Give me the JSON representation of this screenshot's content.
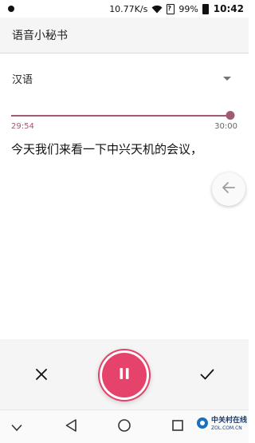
{
  "status_bar": {
    "network_speed": "10.77K/s",
    "sim_badge": "?",
    "battery_percent": "99%",
    "time": "10:42"
  },
  "app_bar": {
    "title": "语音小秘书"
  },
  "language": {
    "selected": "汉语"
  },
  "playback": {
    "progress": 0.98,
    "current_time": "29:54",
    "total_time": "30:00"
  },
  "transcript": {
    "text": "今天我们来看一下中兴天机的会议，"
  },
  "colors": {
    "accent": "#a05a74",
    "record_button": "#e5436b",
    "panel_bg": "#f5f5f5"
  },
  "icons": {
    "side_bubble": "arrow-left-icon",
    "cancel": "close-icon",
    "confirm": "check-icon",
    "pause": "pause-icon",
    "nav_down": "chevron-down-icon",
    "nav_back": "triangle-back-icon",
    "nav_home": "circle-home-icon",
    "nav_recents": "square-recents-icon"
  },
  "watermark": {
    "logo": "中关村在线",
    "url": "ZOL.COM.CN"
  }
}
